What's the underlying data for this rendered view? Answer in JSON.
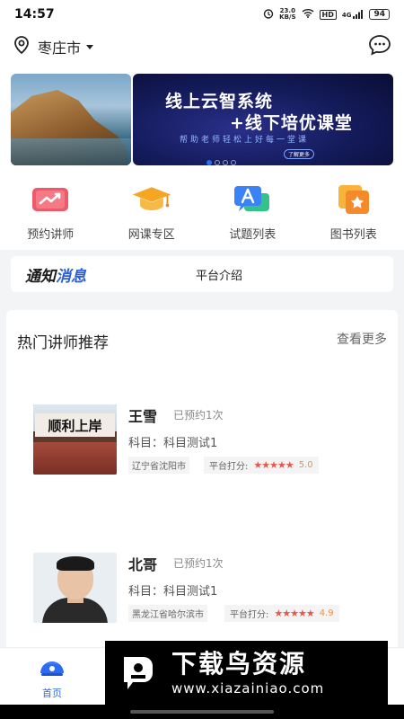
{
  "status_bar": {
    "time": "14:57",
    "net_speed_value": "23.0",
    "net_speed_unit": "KB/S",
    "hd": "HD",
    "signal": "4G",
    "battery": "94"
  },
  "header": {
    "city": "枣庄市"
  },
  "banner": {
    "title_line1": "线上云智系统",
    "title_line2": "+线下培优课堂",
    "subtitle": "帮助老师轻松上好每一堂课",
    "more_button": "了解更多",
    "active_slide": 1,
    "slide_count": 4
  },
  "quick_menu": [
    {
      "label": "预约讲师",
      "icon": "trend-chart-icon"
    },
    {
      "label": "网课专区",
      "icon": "graduation-cap-icon"
    },
    {
      "label": "试题列表",
      "icon": "quiz-chat-icon"
    },
    {
      "label": "图书列表",
      "icon": "book-star-icon"
    }
  ],
  "notice": {
    "tag_black": "通知",
    "tag_blue": "消息",
    "text": "平台介绍"
  },
  "recommend": {
    "title": "热门讲师推荐",
    "more": "查看更多",
    "teachers": [
      {
        "name": "王雪",
        "booked": "已预约1次",
        "subject": "科目：科目测试1",
        "location": "辽宁省沈阳市",
        "rating_label": "平台打分:",
        "stars": "★★★★★",
        "score": "5.0",
        "photo_text": "顺利上岸"
      },
      {
        "name": "北哥",
        "booked": "已预约1次",
        "subject": "科目：科目测试1",
        "location": "黑龙江省哈尔滨市",
        "rating_label": "平台打分:",
        "stars": "★★★★★",
        "score": "4.9"
      }
    ]
  },
  "tabbar": {
    "home_label": "首页"
  },
  "watermark": {
    "name": "下载鸟资源",
    "url": "www.xiazainiao.com"
  },
  "colors": {
    "accent": "#2d6cf0",
    "star": "#e8584a",
    "banner_bg": "#131a58"
  }
}
